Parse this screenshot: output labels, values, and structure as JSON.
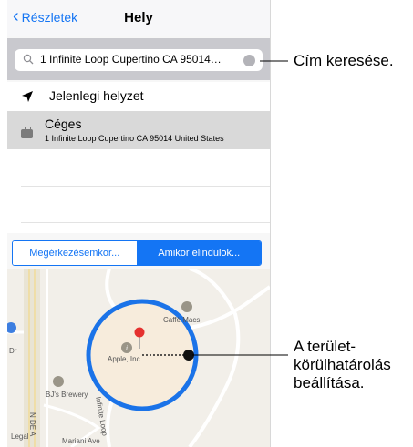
{
  "nav": {
    "back_label": "Részletek",
    "title": "Hely"
  },
  "search": {
    "value": "1 Infinite Loop Cupertino CA 95014…"
  },
  "rows": {
    "current": "Jelenlegi helyzet",
    "company_name": "Céges",
    "company_address": "1 Infinite Loop Cupertino CA 95014 United States"
  },
  "segment": {
    "arriving": "Megérkezésemkor...",
    "leaving": "Amikor elindulok..."
  },
  "map": {
    "place_cafe": "Caffè Macs",
    "place_apple": "Apple, Inc.",
    "place_bjs": "BJ's Brewery",
    "street_infinite": "Infinite Loop",
    "street_mariani": "Mariani Ave",
    "street_n_de_anza": "N DE A",
    "edge_dr": "Dr",
    "legal": "Legal"
  },
  "callouts": {
    "search": "Cím keresése.",
    "geofence": [
      "A terület-",
      "körülhatárolás",
      "beállítása."
    ]
  },
  "colors": {
    "accent": "#1475f4",
    "pin": "#e5312f",
    "geofence": "#1b73e8"
  }
}
